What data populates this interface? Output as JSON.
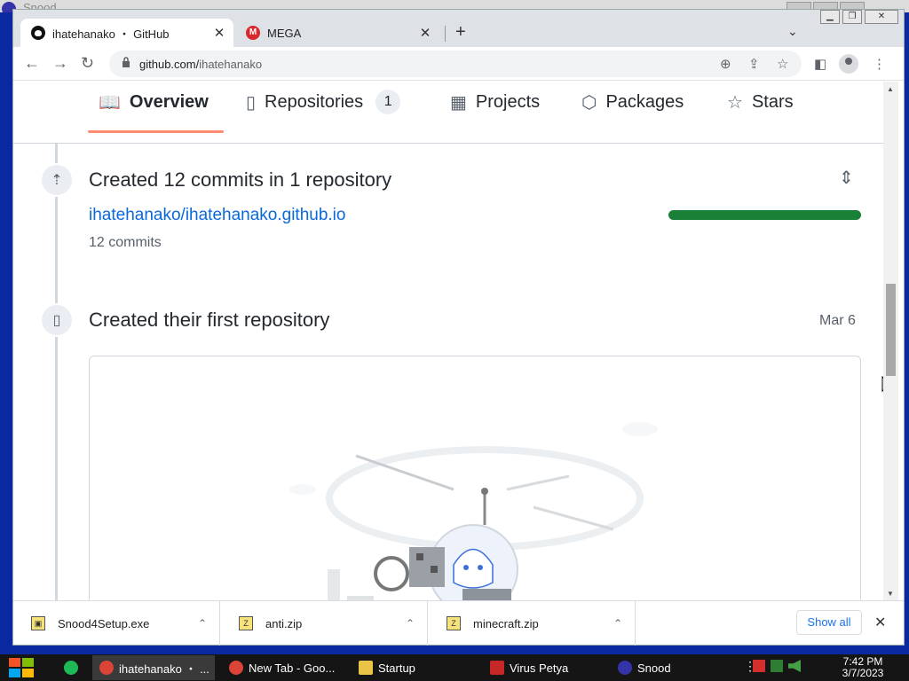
{
  "background_window": {
    "title": "Snood"
  },
  "browser": {
    "tabs": [
      {
        "title": "ihatehanako ・ GitHub",
        "active": true
      },
      {
        "title": "MEGA",
        "active": false
      }
    ],
    "url": {
      "domain": "github.com/",
      "path": "ihatehanako"
    }
  },
  "profile_nav": {
    "tabs": [
      {
        "label": "Overview",
        "icon": "book-icon",
        "selected": true
      },
      {
        "label": "Repositories",
        "icon": "repo-icon",
        "count": "1"
      },
      {
        "label": "Projects",
        "icon": "table-icon"
      },
      {
        "label": "Packages",
        "icon": "package-icon"
      },
      {
        "label": "Stars",
        "icon": "star-icon"
      }
    ]
  },
  "activity": {
    "commits": {
      "title": "Created 12 commits in 1 repository",
      "repo": "ihatehanako/ihatehanako.github.io",
      "count_label": "12 commits",
      "bar_color": "#1a7f37",
      "bar_fraction": 1.0
    },
    "first_repo": {
      "title": "Created their first repository",
      "date": "Mar 6"
    }
  },
  "downloads": {
    "items": [
      {
        "name": "Snood4Setup.exe"
      },
      {
        "name": "anti.zip"
      },
      {
        "name": "minecraft.zip"
      }
    ],
    "show_all": "Show all"
  },
  "taskbar": {
    "items": [
      {
        "label": "ihatehanako ・ ...",
        "icon_color": "#db4437",
        "active": true
      },
      {
        "label": "New Tab - Goo...",
        "icon_color": "#db4437",
        "active": false
      },
      {
        "label": "Startup",
        "icon_color": "#e8c547",
        "active": false
      },
      {
        "label": "Virus Petya",
        "icon_color": "#c62828",
        "active": false
      },
      {
        "label": "Snood",
        "icon_color": "#3333aa",
        "active": false
      }
    ],
    "clock": {
      "time": "7:42 PM",
      "date": "3/7/2023"
    }
  }
}
